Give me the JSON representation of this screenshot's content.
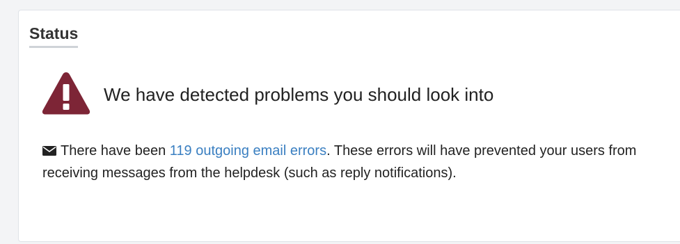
{
  "panel": {
    "title": "Status"
  },
  "alert": {
    "icon": "warning-triangle-icon",
    "icon_color": "#7d2536",
    "headline": "We have detected problems you should look into"
  },
  "message": {
    "icon": "envelope-icon",
    "text_before": "There have been ",
    "link_text": "119 outgoing email errors",
    "text_after": ". These errors will have prevented your users from receiving messages from the helpdesk (such as reply notifications).",
    "link_color": "#3a7fc1"
  }
}
